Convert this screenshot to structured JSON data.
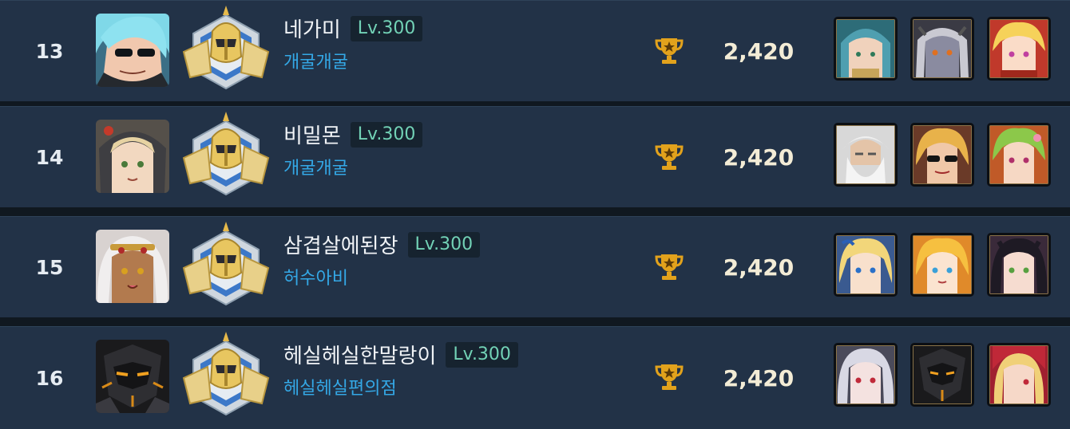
{
  "colors": {
    "row_bg": "#223247",
    "gap_bg": "#101820",
    "name_text": "#f0f3f6",
    "level_text": "#72d2b6",
    "guild_text": "#34a8e6",
    "score_text": "#f3ecd6",
    "trophy": "#e2a21c"
  },
  "rows": [
    {
      "rank": "13",
      "name": "네가미",
      "level": "Lv.300",
      "guild": "개굴개굴",
      "score": "2,420",
      "avatar_icon": "cyan-hair-sunglasses-portrait",
      "heroes": [
        "teal-haired-hero-portrait",
        "grey-demon-hero-portrait",
        "blonde-twin-hero-portrait"
      ]
    },
    {
      "rank": "14",
      "name": "비밀몬",
      "level": "Lv.300",
      "guild": "개굴개굴",
      "score": "2,420",
      "avatar_icon": "hooded-blonde-portrait",
      "heroes": [
        "white-bearded-sage-portrait",
        "sunglasses-blonde-hero-portrait",
        "green-haired-hero-portrait"
      ]
    },
    {
      "rank": "15",
      "name": "삼겹살에된장",
      "level": "Lv.300",
      "guild": "허수아비",
      "score": "2,420",
      "avatar_icon": "white-haired-crowned-portrait",
      "heroes": [
        "blonde-blue-eyed-hero-portrait",
        "blonde-orange-hero-portrait",
        "black-haired-hero-portrait"
      ]
    },
    {
      "rank": "16",
      "name": "헤실헤실한말랑이",
      "level": "Lv.300",
      "guild": "헤실헤실편의점",
      "score": "2,420",
      "avatar_icon": "dark-mech-portrait",
      "heroes": [
        "silver-haired-hero-portrait",
        "dark-mech-hero-portrait",
        "red-hooded-hero-portrait"
      ]
    }
  ]
}
